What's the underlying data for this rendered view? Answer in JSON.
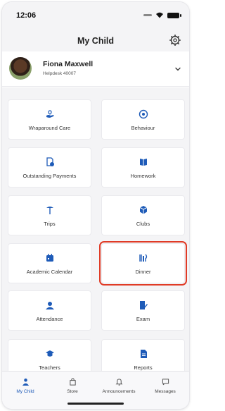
{
  "status_bar": {
    "time": "12:06"
  },
  "header": {
    "title": "My Child",
    "settings_icon": "gear-icon"
  },
  "child": {
    "name": "Fiona Maxwell",
    "school": "Helpdesk 40007"
  },
  "accent_color": "#1e5bb8",
  "highlight_color": "#e03b26",
  "tiles": [
    {
      "label": "Wraparound Care",
      "icon": "care-hand-icon"
    },
    {
      "label": "Behaviour",
      "icon": "behaviour-icon"
    },
    {
      "label": "Outstanding Payments",
      "icon": "payments-icon"
    },
    {
      "label": "Homework",
      "icon": "book-icon"
    },
    {
      "label": "Trips",
      "icon": "trip-icon"
    },
    {
      "label": "Clubs",
      "icon": "clubs-icon"
    },
    {
      "label": "Academic Calendar",
      "icon": "calendar-icon"
    },
    {
      "label": "Dinner",
      "icon": "dinner-icon",
      "highlighted": true
    },
    {
      "label": "Attendance",
      "icon": "attendance-icon"
    },
    {
      "label": "Exam",
      "icon": "exam-icon"
    },
    {
      "label": "Teachers",
      "icon": "teachers-icon"
    },
    {
      "label": "Reports",
      "icon": "reports-icon"
    }
  ],
  "nav": [
    {
      "label": "My Child",
      "icon": "person-icon",
      "active": true
    },
    {
      "label": "Store",
      "icon": "store-icon"
    },
    {
      "label": "Announcements",
      "icon": "bell-icon"
    },
    {
      "label": "Messages",
      "icon": "message-icon"
    }
  ]
}
